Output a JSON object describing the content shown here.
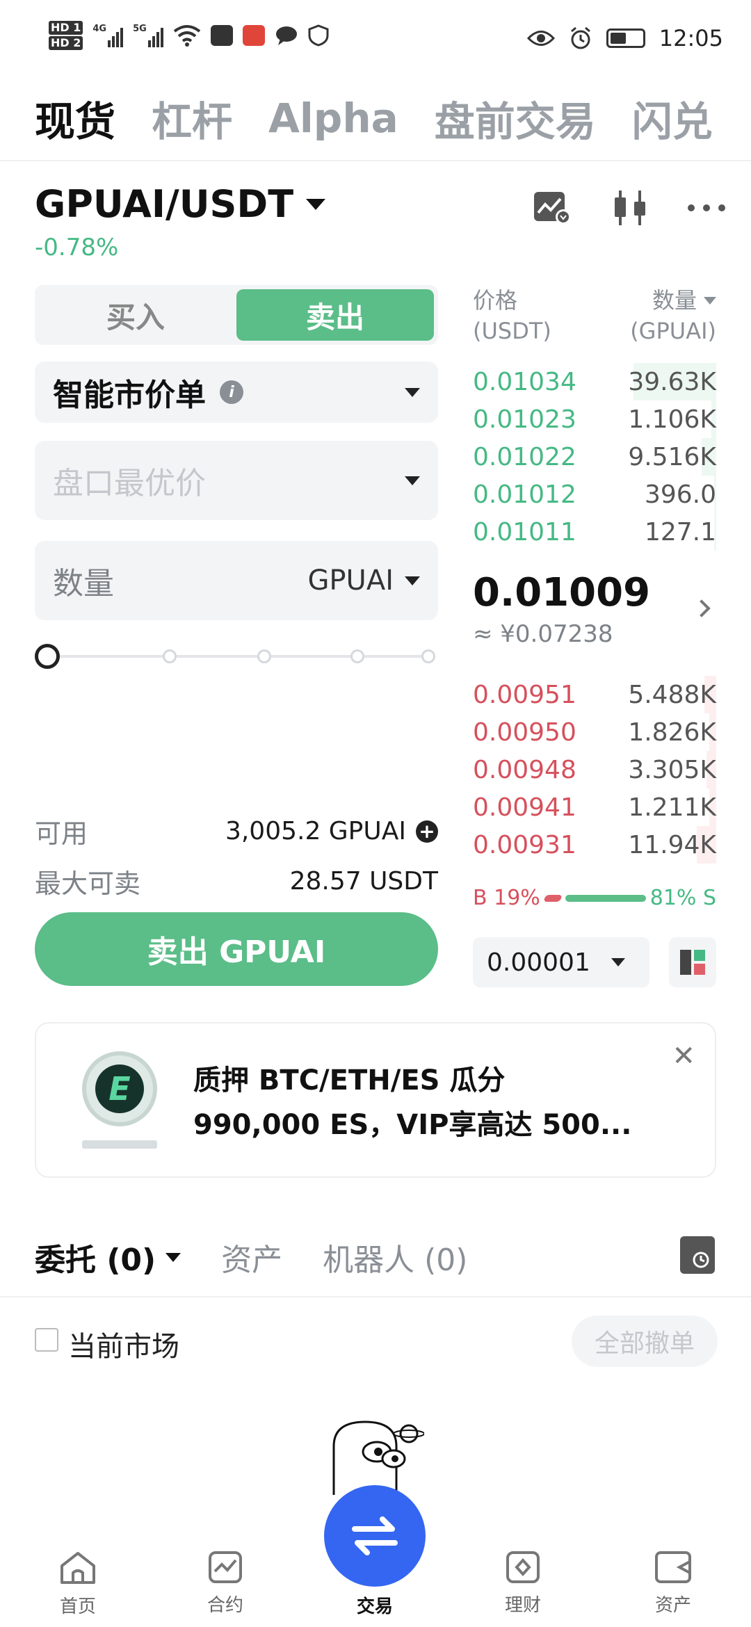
{
  "status_bar": {
    "hd1": "HD 1",
    "hd2": "HD 2",
    "sig1": "4G",
    "sig2": "5G",
    "time": "12:05"
  },
  "top_tabs": [
    "现货",
    "杠杆",
    "Alpha",
    "盘前交易",
    "闪兑"
  ],
  "pair": {
    "symbol": "GPUAI/USDT",
    "change": "-0.78%"
  },
  "trade_form": {
    "buy_label": "买入",
    "sell_label": "卖出",
    "order_type": "智能市价单",
    "price_placeholder": "盘口最优价",
    "amount_label": "数量",
    "amount_unit": "GPUAI",
    "slider_percent": 0,
    "available_label": "可用",
    "available_value": "3,005.2 GPUAI",
    "max_sell_label": "最大可卖",
    "max_sell_value": "28.57 USDT",
    "submit_label": "卖出 GPUAI"
  },
  "order_book": {
    "price_header": "价格",
    "price_unit": "(USDT)",
    "qty_header": "数量",
    "qty_unit": "(GPUAI)",
    "asks": [
      {
        "price": "0.01034",
        "qty": "39.63K",
        "depth": 0.34
      },
      {
        "price": "0.01023",
        "qty": "1.106K",
        "depth": 0.02
      },
      {
        "price": "0.01022",
        "qty": "9.516K",
        "depth": 0.06
      },
      {
        "price": "0.01012",
        "qty": "396.0",
        "depth": 0.01
      },
      {
        "price": "0.01011",
        "qty": "127.1",
        "depth": 0.01
      }
    ],
    "last_price": "0.01009",
    "last_price_cny": "≈ ¥0.07238",
    "bids": [
      {
        "price": "0.00951",
        "qty": "5.488K",
        "depth": 0.05
      },
      {
        "price": "0.00950",
        "qty": "1.826K",
        "depth": 0.03
      },
      {
        "price": "0.00948",
        "qty": "3.305K",
        "depth": 0.04
      },
      {
        "price": "0.00941",
        "qty": "1.211K",
        "depth": 0.03
      },
      {
        "price": "0.00931",
        "qty": "11.94K",
        "depth": 0.08
      }
    ],
    "buy_ratio": "B 19%",
    "sell_ratio": "81% S",
    "precision": "0.00001"
  },
  "banner": {
    "line1": "质押 BTC/ETH/ES 瓜分",
    "line2": "990,000 ES，VIP享高达 500...",
    "logo_letter": "E"
  },
  "orders": {
    "tab_orders": "委托 (0)",
    "tab_assets": "资产",
    "tab_bots": "机器人 (0)",
    "current_market": "当前市场",
    "cancel_all": "全部撤单"
  },
  "bottom_nav": {
    "home": "首页",
    "futures": "合约",
    "trade": "交易",
    "earn": "理财",
    "assets": "资产"
  },
  "colors": {
    "green": "#5bbd88",
    "red": "#d5505c",
    "blue": "#3466f2"
  }
}
